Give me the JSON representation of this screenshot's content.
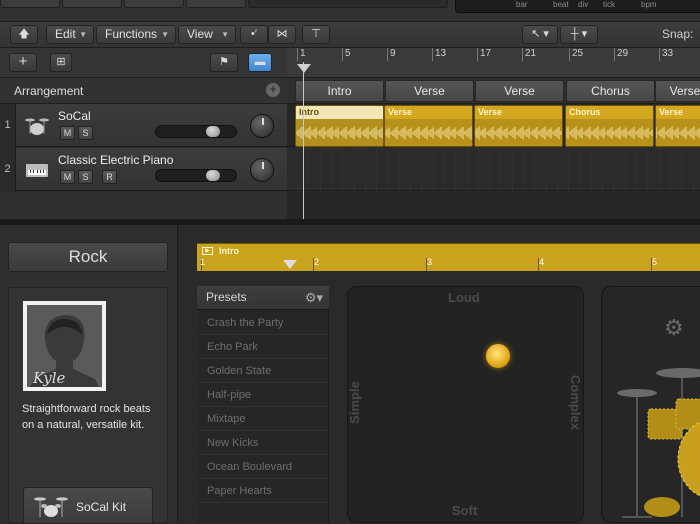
{
  "lcd": {
    "labels": [
      "bar",
      "beat",
      "div",
      "tick",
      "bpm"
    ]
  },
  "toolbar": {
    "edit_label": "Edit",
    "functions_label": "Functions",
    "view_label": "View",
    "snap_label": "Snap:"
  },
  "ruler": {
    "bars": [
      "1",
      "5",
      "9",
      "13",
      "17",
      "21",
      "25",
      "29",
      "33"
    ]
  },
  "arrangement": {
    "label": "Arrangement",
    "markers": [
      "Intro",
      "Verse",
      "Verse",
      "Chorus",
      "Verse"
    ]
  },
  "tracks": [
    {
      "number": "1",
      "name": "SoCal",
      "buttons": [
        "M",
        "S"
      ],
      "regions": [
        "Intro",
        "Verse",
        "Verse",
        "Chorus",
        "Verse"
      ]
    },
    {
      "number": "2",
      "name": "Classic Electric Piano",
      "buttons": [
        "M",
        "S",
        "R"
      ]
    }
  ],
  "drummer": {
    "genre": "Rock",
    "avatar_signature": "Kyle",
    "description": "Straightforward rock beats on a natural, versatile kit.",
    "kit_label": "SoCal Kit"
  },
  "editor": {
    "region_title": "Intro",
    "bars": [
      "1",
      "2",
      "3",
      "4",
      "5"
    ]
  },
  "presets": {
    "header": "Presets",
    "items": [
      "Crash the Party",
      "Echo Park",
      "Golden State",
      "Half-pipe",
      "Mixtape",
      "New Kicks",
      "Ocean Boulevard",
      "Paper Hearts"
    ]
  },
  "xypad": {
    "top": "Loud",
    "bottom": "Soft",
    "left": "Simple",
    "right": "Complex"
  },
  "colors": {
    "region": "#c9a21e",
    "puck": "#f2c32f",
    "accent": "#5aa0e6"
  }
}
